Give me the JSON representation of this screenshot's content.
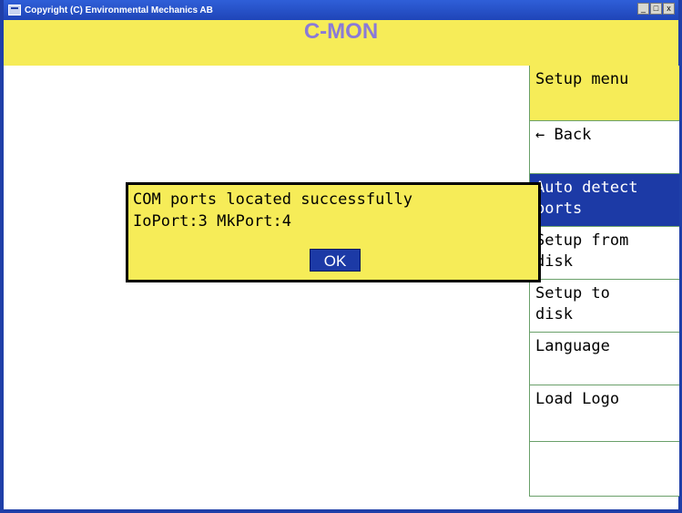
{
  "window": {
    "title": "Copyright (C) Environmental Mechanics AB",
    "controls": {
      "minimize": "_",
      "maximize": "□",
      "close": "x"
    }
  },
  "app": {
    "title": "C-MON"
  },
  "menu": {
    "header": "Setup menu",
    "items": [
      {
        "label": "← Back"
      },
      {
        "label": "Auto detect\nports",
        "selected": true
      },
      {
        "label": "Setup from\ndisk"
      },
      {
        "label": "Setup to\ndisk"
      },
      {
        "label": "Language"
      },
      {
        "label": "Load Logo"
      }
    ],
    "scroll_down_icon": "triangle-down-icon"
  },
  "dialog": {
    "message_line1": "COM ports located successfully",
    "message_line2": "IoPort:3 MkPort:4",
    "ok_label": "OK"
  },
  "colors": {
    "title_bar": "#2f5fd8",
    "header_yellow": "#f6ec58",
    "app_title": "#8a7ad8",
    "selected_blue": "#1c3aa6",
    "divider_green": "#6aa06a"
  }
}
